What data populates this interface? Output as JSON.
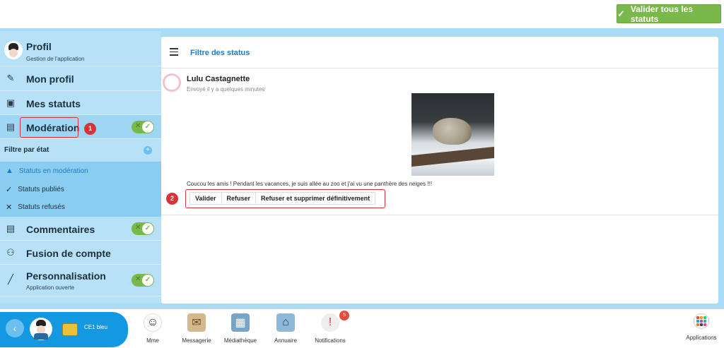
{
  "header": {
    "validate_all_label": "Valider tous les statuts"
  },
  "sidebar": {
    "profile": {
      "title": "Profil",
      "subtitle": "Gestion de l'application"
    },
    "items": [
      {
        "label": "Mon profil",
        "icon": "pencil-icon"
      },
      {
        "label": "Mes statuts",
        "icon": "status-icon"
      },
      {
        "label": "Modération",
        "icon": "chat-icon",
        "toggle": true
      },
      {
        "label": "Commentaires",
        "icon": "comment-icon",
        "toggle": true
      },
      {
        "label": "Fusion de compte",
        "icon": "people-icon"
      },
      {
        "label": "Personnalisation",
        "subtitle": "Application ouverte",
        "icon": "brush-icon",
        "toggle": true
      }
    ],
    "filter": {
      "header": "Filtre par état",
      "options": [
        {
          "label": "Statuts en modération",
          "active": true
        },
        {
          "label": "Statuts publiés",
          "active": false
        },
        {
          "label": "Statuts refusés",
          "active": false
        }
      ]
    }
  },
  "annotations": {
    "badge1": "1",
    "badge2": "2"
  },
  "content": {
    "title": "Filtre des status",
    "post": {
      "author": "Lulu Castagnette",
      "sent": "Envoyé il y a quelques minutes",
      "text": "Coucou les amis ! Pendant les vacances, je suis allée au zoo et j'ai vu une panthère des neiges !!!",
      "actions": [
        "Valider",
        "Refuser",
        "Refuser et supprimer définitivement"
      ]
    }
  },
  "dock": {
    "class_label": "CE1 bleu",
    "apps": [
      {
        "label": "Mme",
        "icon": "teacher-icon"
      },
      {
        "label": "Messagerie",
        "icon": "mail-icon"
      },
      {
        "label": "Médiathèque",
        "icon": "media-icon"
      },
      {
        "label": "Annuaire",
        "icon": "directory-icon"
      },
      {
        "label": "Notifications",
        "icon": "notification-icon",
        "badge": "5"
      }
    ],
    "apps_button": "Applications"
  },
  "colors": {
    "accent_green": "#79b84a",
    "accent_blue": "#1f7bc1",
    "annotation_red": "#d9333a"
  }
}
